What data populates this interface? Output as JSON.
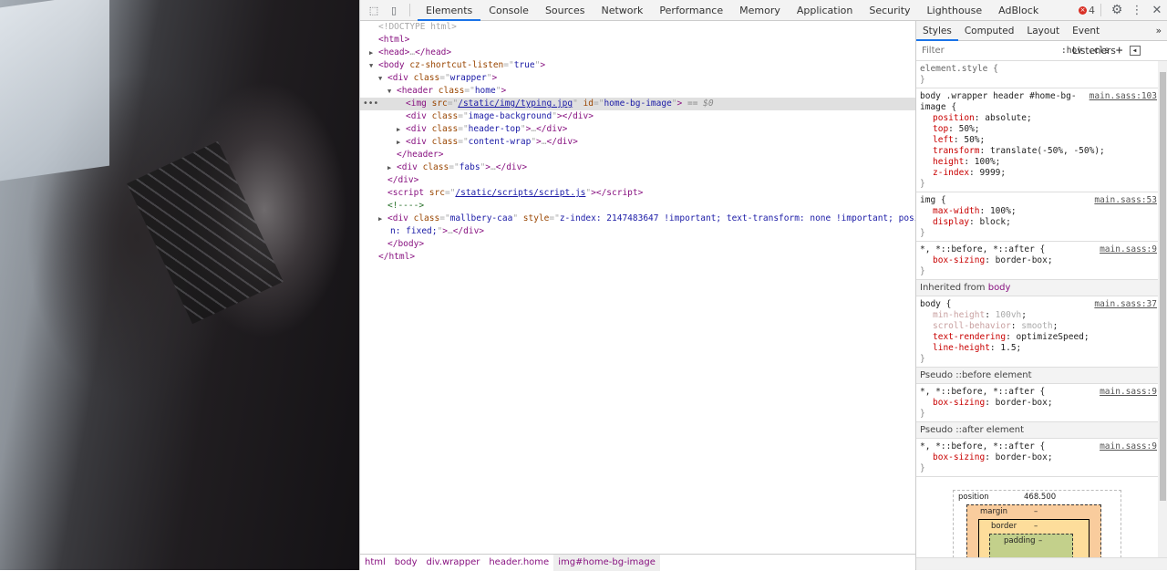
{
  "toolbar": {
    "tabs": [
      "Elements",
      "Console",
      "Sources",
      "Network",
      "Performance",
      "Memory",
      "Application",
      "Security",
      "Lighthouse",
      "AdBlock"
    ],
    "active": "Elements",
    "error_count": "4"
  },
  "dom_lines": [
    {
      "indent": 0,
      "tri": "",
      "tokens": [
        [
          "gray",
          "<!DOCTYPE html>"
        ]
      ]
    },
    {
      "indent": 0,
      "tri": "",
      "tokens": [
        [
          "tag",
          "<html>"
        ]
      ]
    },
    {
      "indent": 0,
      "tri": "▶",
      "tokens": [
        [
          "tag",
          "<head>"
        ],
        [
          "punc",
          "…"
        ],
        [
          "tag",
          "</head>"
        ]
      ]
    },
    {
      "indent": 0,
      "tri": "▼",
      "tokens": [
        [
          "tag",
          "<body "
        ],
        [
          "attr",
          "cz-shortcut-listen"
        ],
        [
          "punc",
          "=\""
        ],
        [
          "val",
          "true"
        ],
        [
          "punc",
          "\""
        ],
        [
          "tag",
          ">"
        ]
      ]
    },
    {
      "indent": 1,
      "tri": "▼",
      "tokens": [
        [
          "tag",
          "<div "
        ],
        [
          "attr",
          "class"
        ],
        [
          "punc",
          "=\""
        ],
        [
          "val",
          "wrapper"
        ],
        [
          "punc",
          "\""
        ],
        [
          "tag",
          ">"
        ]
      ]
    },
    {
      "indent": 2,
      "tri": "▼",
      "tokens": [
        [
          "tag",
          "<header "
        ],
        [
          "attr",
          "class"
        ],
        [
          "punc",
          "=\""
        ],
        [
          "val",
          "home"
        ],
        [
          "punc",
          "\""
        ],
        [
          "tag",
          ">"
        ]
      ]
    },
    {
      "indent": 3,
      "tri": "",
      "selected": true,
      "tokens": [
        [
          "tag",
          "<img "
        ],
        [
          "attr",
          "src"
        ],
        [
          "punc",
          "=\""
        ],
        [
          "link",
          "/static/img/typing.jpg"
        ],
        [
          "punc",
          "\" "
        ],
        [
          "attr",
          "id"
        ],
        [
          "punc",
          "=\""
        ],
        [
          "val",
          "home-bg-image"
        ],
        [
          "punc",
          "\""
        ],
        [
          "tag",
          ">"
        ],
        [
          "dim",
          " == $0"
        ]
      ]
    },
    {
      "indent": 3,
      "tri": "",
      "tokens": [
        [
          "tag",
          "<div "
        ],
        [
          "attr",
          "class"
        ],
        [
          "punc",
          "=\""
        ],
        [
          "val",
          "image-background"
        ],
        [
          "punc",
          "\""
        ],
        [
          "tag",
          "></div>"
        ]
      ]
    },
    {
      "indent": 3,
      "tri": "▶",
      "tokens": [
        [
          "tag",
          "<div "
        ],
        [
          "attr",
          "class"
        ],
        [
          "punc",
          "=\""
        ],
        [
          "val",
          "header-top"
        ],
        [
          "punc",
          "\""
        ],
        [
          "tag",
          ">"
        ],
        [
          "punc",
          "…"
        ],
        [
          "tag",
          "</div>"
        ]
      ]
    },
    {
      "indent": 3,
      "tri": "▶",
      "tokens": [
        [
          "tag",
          "<div "
        ],
        [
          "attr",
          "class"
        ],
        [
          "punc",
          "=\""
        ],
        [
          "val",
          "content-wrap"
        ],
        [
          "punc",
          "\""
        ],
        [
          "tag",
          ">"
        ],
        [
          "punc",
          "…"
        ],
        [
          "tag",
          "</div>"
        ]
      ]
    },
    {
      "indent": 2,
      "tri": "",
      "tokens": [
        [
          "tag",
          "</header>"
        ]
      ]
    },
    {
      "indent": 2,
      "tri": "▶",
      "tokens": [
        [
          "tag",
          "<div "
        ],
        [
          "attr",
          "class"
        ],
        [
          "punc",
          "=\""
        ],
        [
          "val",
          "fabs"
        ],
        [
          "punc",
          "\""
        ],
        [
          "tag",
          ">"
        ],
        [
          "punc",
          "…"
        ],
        [
          "tag",
          "</div>"
        ]
      ]
    },
    {
      "indent": 1,
      "tri": "",
      "tokens": [
        [
          "tag",
          "</div>"
        ]
      ]
    },
    {
      "indent": 1,
      "tri": "",
      "tokens": [
        [
          "tag",
          "<script "
        ],
        [
          "attr",
          "src"
        ],
        [
          "punc",
          "=\""
        ],
        [
          "link",
          "/static/scripts/script.js"
        ],
        [
          "punc",
          "\""
        ],
        [
          "tag",
          "></script>"
        ]
      ]
    },
    {
      "indent": 1,
      "tri": "",
      "tokens": [
        [
          "com",
          "<!---->"
        ]
      ]
    },
    {
      "indent": 1,
      "tri": "▶",
      "tokens": [
        [
          "tag",
          "<div "
        ],
        [
          "attr",
          "class"
        ],
        [
          "punc",
          "=\""
        ],
        [
          "val",
          "mallbery-caa"
        ],
        [
          "punc",
          "\" "
        ],
        [
          "attr",
          "style"
        ],
        [
          "punc",
          "=\""
        ],
        [
          "val",
          "z-index: 2147483647 !important; text-transform: none !important; positio"
        ]
      ]
    },
    {
      "indent": 0,
      "tri": "",
      "tokens": [
        [
          "val",
          "n: fixed;"
        ],
        [
          "punc",
          "\""
        ],
        [
          "tag",
          ">"
        ],
        [
          "punc",
          "…"
        ],
        [
          "tag",
          "</div>"
        ]
      ]
    },
    {
      "indent": 1,
      "tri": "",
      "tokens": [
        [
          "tag",
          "</body>"
        ]
      ]
    },
    {
      "indent": 0,
      "tri": "",
      "tokens": [
        [
          "tag",
          "</html>"
        ]
      ]
    }
  ],
  "breadcrumbs": [
    "html",
    "body",
    "div.wrapper",
    "header.home",
    "img#home-bg-image"
  ],
  "styles": {
    "tabs": [
      "Styles",
      "Computed",
      "Layout",
      "Event Listeners"
    ],
    "filter_placeholder": "Filter",
    "hov": ":hov",
    "cls": ".cls",
    "rules": [
      {
        "selector": "element.style {",
        "source": "",
        "props": []
      },
      {
        "selector": "body .wrapper header #home-bg-\nimage {",
        "source": "main.sass:103",
        "props": [
          [
            "position",
            "absolute"
          ],
          [
            "top",
            "50%"
          ],
          [
            "left",
            "50%"
          ],
          [
            "transform",
            "translate(-50%, -50%)"
          ],
          [
            "height",
            "100%"
          ],
          [
            "z-index",
            "9999"
          ]
        ]
      },
      {
        "selector": "img {",
        "source": "main.sass:53",
        "props": [
          [
            "max-width",
            "100%"
          ],
          [
            "display",
            "block"
          ]
        ]
      },
      {
        "selector": "*, *::before, *::after {",
        "source": "main.sass:9",
        "props": [
          [
            "box-sizing",
            "border-box"
          ]
        ]
      },
      {
        "header": "Inherited from ",
        "header_tag": "body"
      },
      {
        "selector": "body {",
        "source": "main.sass:37",
        "props": [
          [
            "min-height",
            "100vh",
            true
          ],
          [
            "scroll-behavior",
            "smooth",
            true
          ],
          [
            "text-rendering",
            "optimizeSpeed"
          ],
          [
            "line-height",
            "1.5"
          ]
        ]
      },
      {
        "header": "Pseudo ::before element"
      },
      {
        "selector": "*, *::before, *::after {",
        "source": "main.sass:9",
        "props": [
          [
            "box-sizing",
            "border-box"
          ]
        ]
      },
      {
        "header": "Pseudo ::after element"
      },
      {
        "selector": "*, *::before, *::after {",
        "source": "main.sass:9",
        "props": [
          [
            "box-sizing",
            "border-box"
          ]
        ]
      }
    ],
    "box_model": {
      "position_label": "position",
      "position_value": "468.500",
      "margin_label": "margin",
      "margin_value": "–",
      "border_label": "border",
      "border_value": "–",
      "padding_label": "padding",
      "padding_value": "–"
    }
  }
}
